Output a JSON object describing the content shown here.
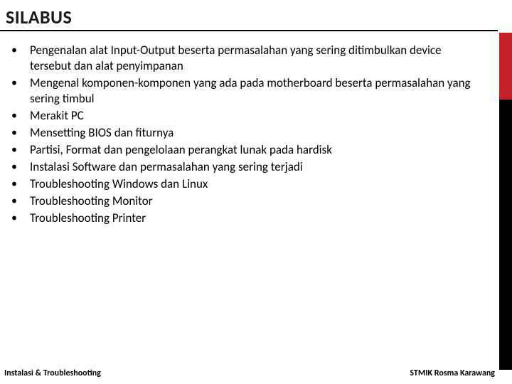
{
  "title": "SILABUS",
  "bullets": [
    "Pengenalan alat Input-Output beserta permasalahan yang sering ditimbulkan device tersebut dan alat penyimpanan",
    "Mengenal komponen-komponen yang ada pada motherboard beserta permasalahan yang sering timbul",
    "Merakit PC",
    "Mensetting BIOS dan fiturnya",
    "Partisi, Format dan pengelolaan perangkat lunak pada hardisk",
    "Instalasi Software dan permasalahan yang sering terjadi",
    "Troubleshooting Windows dan Linux",
    "Troubleshooting Monitor",
    "Troubleshooting Printer"
  ],
  "footer": {
    "left": "Instalasi & Troubleshooting",
    "right": "STMIK Rosma Karawang"
  }
}
